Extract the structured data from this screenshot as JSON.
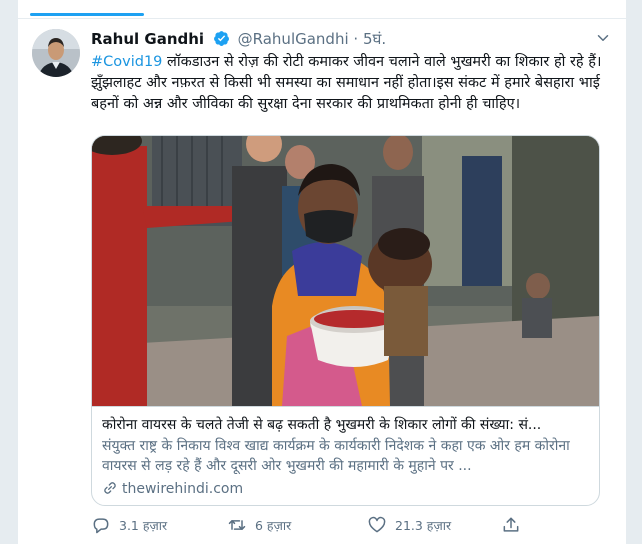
{
  "tweet": {
    "author": {
      "name": "Rahul Gandhi",
      "handle": "@RahulGandhi",
      "separator": "·",
      "time": "5घं."
    },
    "text": {
      "hashtag": "#Covid19",
      "body": " लॉकडाउन से रोज़ की रोटी कमाकर जीवन चलाने वाले भुखमरी का शिकार हो रहे हैं। झुँझलाहट और नफ़रत से किसी भी समस्या का समाधान नहीं होता।इस संकट में हमारे बेसहारा भाई बहनों को अन्न और जीविका की सुरक्षा देना सरकार की प्राथमिकता होनी ही चाहिए।"
    },
    "card": {
      "title": "कोरोना वायरस के चलते तेजी से बढ़ सकती है भुखमरी के शिकार लोगों की संख्या: सं...",
      "description": "संयुक्त राष्ट्र के निकाय विश्व खाद्य कार्यक्रम के कार्यकारी निदेशक ने कहा एक ओर हम कोरोना वायरस से लड़ रहे हैं और दूसरी ओर भुखमरी की महामारी के मुहाने पर ...",
      "domain": "thewirehindi.com"
    },
    "actions": {
      "replies": "3.1 हज़ार",
      "retweets": "6 हज़ार",
      "likes": "21.3 हज़ार"
    }
  },
  "icons": {
    "verified": "verified-badge-icon",
    "caret": "chevron-down-icon",
    "link": "link-icon",
    "reply": "reply-icon",
    "retweet": "retweet-icon",
    "like": "heart-icon",
    "share": "share-icon"
  },
  "colors": {
    "accent": "#1da1f2",
    "hashtag": "#1b95e0",
    "secondary_text": "#5b7083",
    "border": "#cfd9de"
  }
}
